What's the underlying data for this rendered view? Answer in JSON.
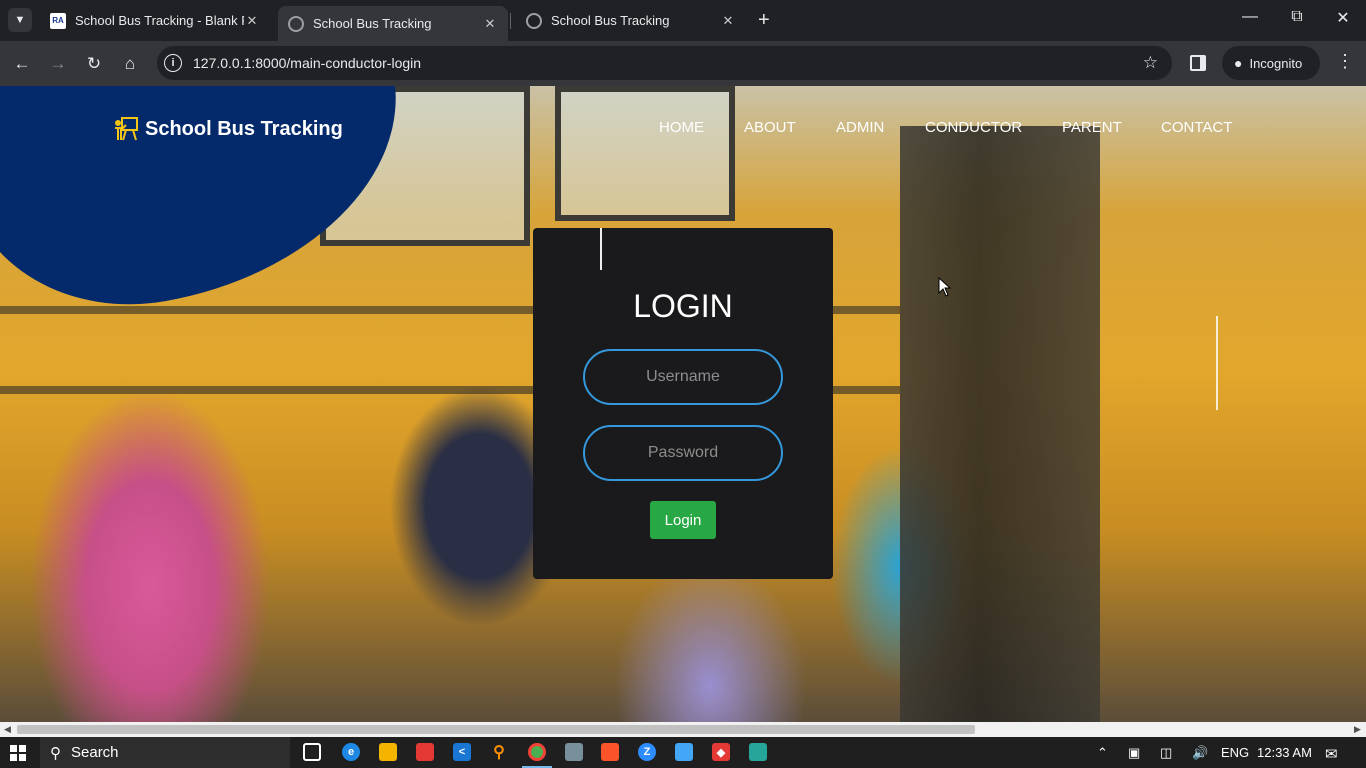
{
  "browser": {
    "tabs": [
      {
        "title": "School Bus Tracking - Blank Pa",
        "favicon": "ra-icon",
        "active": false
      },
      {
        "title": "School Bus Tracking",
        "favicon": "globe-icon",
        "active": true
      },
      {
        "title": "School Bus Tracking",
        "favicon": "globe-icon",
        "active": false
      }
    ],
    "url": "127.0.0.1:8000/main-conductor-login",
    "profile_label": "Incognito"
  },
  "site": {
    "brand": "School Bus Tracking",
    "nav": [
      "HOME",
      "ABOUT",
      "ADMIN",
      "CONDUCTOR",
      "PARENT",
      "CONTACT"
    ]
  },
  "login": {
    "title": "LOGIN",
    "username_placeholder": "Username",
    "password_placeholder": "Password",
    "button_label": "Login"
  },
  "taskbar": {
    "search_label": "Search",
    "language": "ENG",
    "time": "12:33 AM"
  },
  "colors": {
    "blob": "#052a6b",
    "card": "#1a1a1c",
    "input_border": "#3498db",
    "button": "#28a745"
  }
}
